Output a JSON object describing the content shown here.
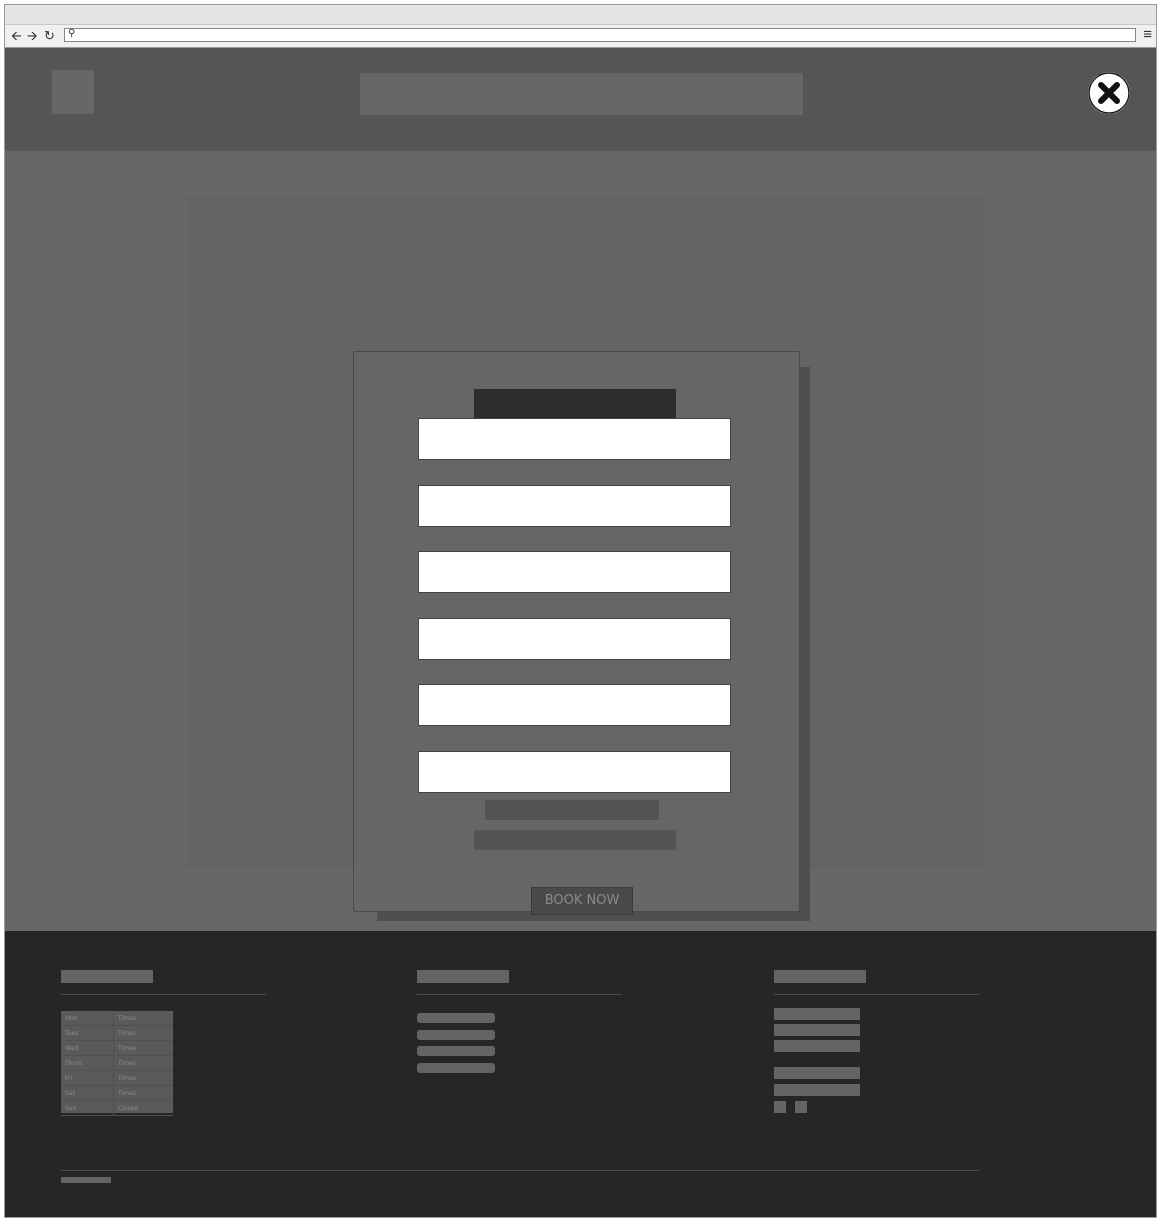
{
  "browser": {
    "back_icon": "arrow-left-icon",
    "forward_icon": "arrow-right-icon",
    "reload_icon": "reload-icon",
    "search_icon": "search-icon",
    "menu_icon": "hamburger-menu-icon",
    "url": ""
  },
  "header": {
    "close_icon": "close-x-icon"
  },
  "modal": {
    "fields": [
      {
        "value": "",
        "placeholder": ""
      },
      {
        "value": "",
        "placeholder": ""
      },
      {
        "value": "",
        "placeholder": ""
      },
      {
        "value": "",
        "placeholder": ""
      },
      {
        "value": "",
        "placeholder": ""
      },
      {
        "value": "",
        "placeholder": ""
      }
    ]
  },
  "main": {
    "book_label": "BOOK NOW"
  },
  "footer": {
    "hours": [
      {
        "day": "Mon",
        "time": "Times"
      },
      {
        "day": "Tues",
        "time": "Times"
      },
      {
        "day": "Wed",
        "time": "Times"
      },
      {
        "day": "Thurs",
        "time": "Times"
      },
      {
        "day": "Fri",
        "time": "Times"
      },
      {
        "day": "Sat",
        "time": "Times"
      },
      {
        "day": "Sun",
        "time": "Closed"
      }
    ]
  },
  "colors": {
    "header_bg": "#555555",
    "main_bg": "#676767",
    "footer_bg": "#262626",
    "field_bg": "#ffffff",
    "button_bg": "#4a4a4a"
  }
}
